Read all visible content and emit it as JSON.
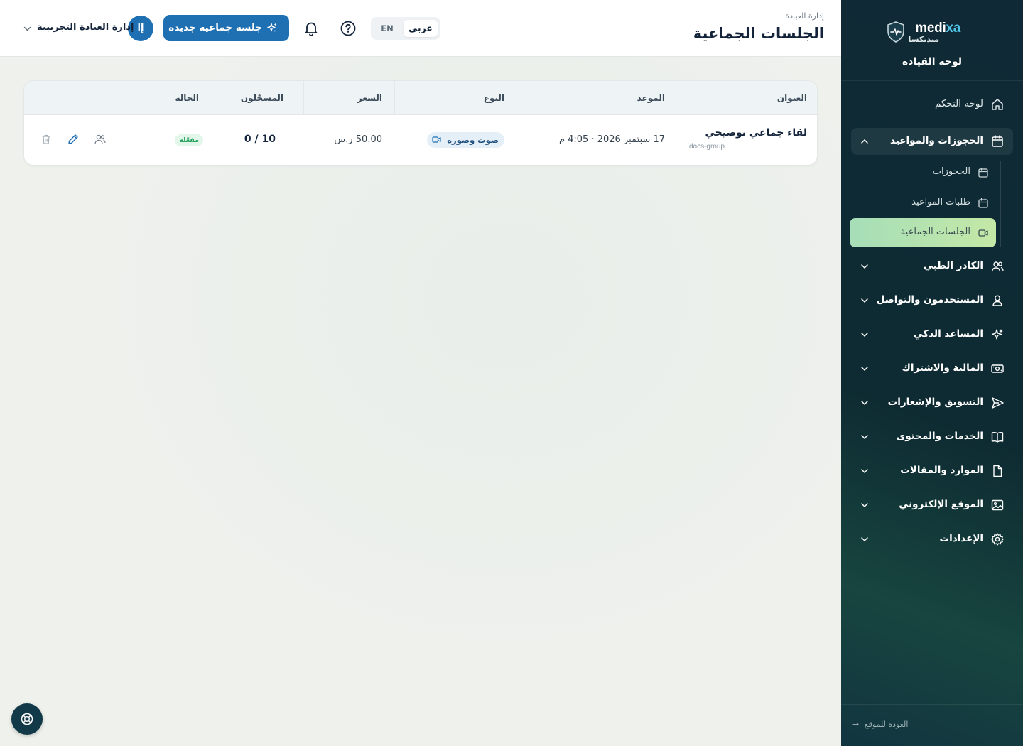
{
  "brand": {
    "name_part1": "medi",
    "name_part2": "xa",
    "name_arabic": "ميديكسا",
    "dashboard_title": "لوحة القيادة"
  },
  "colors": {
    "primary": "#1f6fb3",
    "sidebar_bg": "#0f2a36",
    "active_item": "#c4e8a6",
    "status_green": "#24a05b"
  },
  "sidebar": {
    "items": [
      {
        "label": "لوحة التحكم",
        "icon": "home-icon"
      },
      {
        "label": "الحجوزات والمواعيد",
        "icon": "calendar-icon",
        "expanded": true,
        "children": [
          {
            "label": "الحجوزات",
            "icon": "calendar-icon"
          },
          {
            "label": "طلبات المواعيد",
            "icon": "calendar-icon"
          },
          {
            "label": "الجلسات الجماعية",
            "icon": "video-icon",
            "active": true
          }
        ]
      },
      {
        "label": "الكادر الطبي",
        "icon": "users-icon"
      },
      {
        "label": "المستخدمون والتواصل",
        "icon": "user-icon"
      },
      {
        "label": "المساعد الذكي",
        "icon": "sparkles-icon"
      },
      {
        "label": "المالية والاشتراك",
        "icon": "money-icon"
      },
      {
        "label": "التسويق والإشعارات",
        "icon": "send-icon"
      },
      {
        "label": "الخدمات والمحتوى",
        "icon": "book-icon"
      },
      {
        "label": "الموارد والمقالات",
        "icon": "file-icon"
      },
      {
        "label": "الموقع الإلكتروني",
        "icon": "image-icon"
      },
      {
        "label": "الإعدادات",
        "icon": "gear-icon"
      }
    ],
    "back_link": "العودة للموقع"
  },
  "header": {
    "breadcrumb": "إدارة العيادة",
    "title": "الجلسات الجماعية",
    "lang_ar": "عربي",
    "lang_en": "EN",
    "new_button": "جلسة جماعية جديدة",
    "avatar_initials": "إا",
    "clinic_name": "إدارة العيادة التجريبية"
  },
  "table": {
    "columns": [
      "العنوان",
      "الموعد",
      "النوع",
      "السعر",
      "المسجّلون",
      "الحالة"
    ],
    "rows": [
      {
        "title": "لقاء جماعي توضيحي",
        "slug": "docs-group",
        "date": "17 سبتمبر 2026 · 4:05 م",
        "type": "صوت وصورة",
        "price": "50.00 ر.س",
        "registered": "0 / 10",
        "status": "مفعّلة"
      }
    ]
  }
}
